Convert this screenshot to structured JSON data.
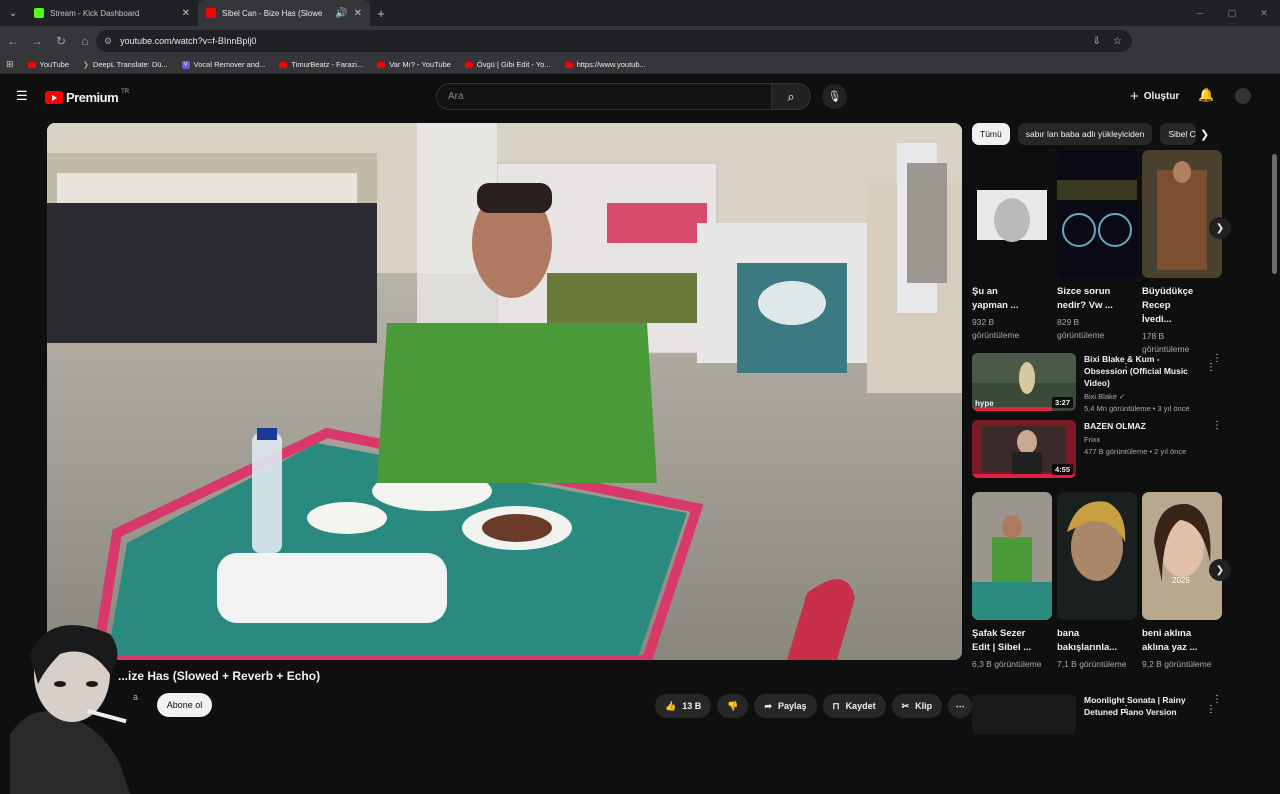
{
  "browser": {
    "tabs": [
      {
        "title": "Stream - Kick Dashboard",
        "favicon_color": "#53fc18"
      },
      {
        "title": "Sibel Can - Bize Has (Slowe",
        "favicon_color": "#ff0000"
      }
    ],
    "url": "youtube.com/watch?v=f-BInnBplj0",
    "bookmarks": [
      "YouTube",
      "DeepL Translate: Dü...",
      "Vocal Remover and...",
      "TimurBeatz - Farazi...",
      "Var Mı? - YouTube",
      "Övgü | Gibi Edit - Yo...",
      "https://www.youtub..."
    ]
  },
  "youtube": {
    "logo_text": "Premium",
    "logo_region": "TR",
    "search_placeholder": "Ara",
    "create_label": "Oluştur",
    "video_title": "...ize Has (Slowed + Reverb + Echo)",
    "channel_partial": "a",
    "subscribe_label": "Abone ol",
    "like_count": "13 B",
    "share_label": "Paylaş",
    "save_label": "Kaydet",
    "clip_label": "Klip",
    "chips": [
      "Tümü",
      "sabır lan baba adlı yükleyiciden",
      "Sibel C"
    ],
    "shorts_row1": [
      {
        "title": "Şu an yapman ...",
        "views": "932 B görüntüleme"
      },
      {
        "title": "Sizce sorun nedir? Vw ...",
        "views": "829 B görüntüleme"
      },
      {
        "title": "Büyüdükçe Recep İvedi...",
        "views": "178 B görüntüleme"
      }
    ],
    "videos": [
      {
        "title": "Bixi Blake & Kum - Obsession (Official Music Video)",
        "channel": "Bixi Blake",
        "meta": "5,4 Mn görüntüleme • 3 yıl önce",
        "duration": "3:27",
        "overlay": "hype"
      },
      {
        "title": "BAZEN OLMAZ",
        "channel": "Frixx",
        "meta": "477 B görüntüleme • 2 yıl önce",
        "duration": "4:55"
      }
    ],
    "shorts_row2": [
      {
        "title": "Şafak Sezer Edit | Sibel ...",
        "views": "6,3 B görüntüleme"
      },
      {
        "title": "bana bakışlarınla...",
        "views": "7,1 B görüntüleme"
      },
      {
        "title": "beni aklına aklına yaz ...",
        "views": "9,2 B görüntüleme",
        "overlay": "2025"
      }
    ],
    "bottom_video": {
      "title": "Moonlight Sonata | Rainy Detuned Piano Version"
    }
  }
}
